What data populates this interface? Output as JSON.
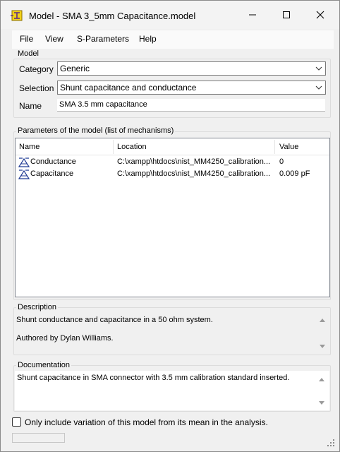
{
  "window": {
    "title": "Model - SMA 3_5mm Capacitance.model"
  },
  "menu": {
    "items": [
      "File",
      "View",
      "S-Parameters",
      "Help"
    ]
  },
  "model_group": {
    "title": "Model",
    "category_label": "Category",
    "category_value": "Generic",
    "selection_label": "Selection",
    "selection_value": "Shunt capacitance and conductance",
    "name_label": "Name",
    "name_value": "SMA 3.5 mm capacitance"
  },
  "parameters_group": {
    "title": "Parameters of the model (list of mechanisms)",
    "columns": [
      "Name",
      "Location",
      "Value"
    ],
    "rows": [
      {
        "name": "Conductance",
        "location": "C:\\xampp\\htdocs\\nist_MM4250_calibration...",
        "value": "0",
        "icon": "mechanism-icon"
      },
      {
        "name": "Capacitance",
        "location": "C:\\xampp\\htdocs\\nist_MM4250_calibration...",
        "value": "0.009  pF",
        "icon": "mechanism-icon"
      }
    ]
  },
  "description_group": {
    "title": "Description",
    "line1": "Shunt conductance and capacitance in a 50 ohm system.",
    "line2": "Authored by Dylan Williams."
  },
  "documentation_group": {
    "title": "Documentation",
    "text": "Shunt capacitance in SMA connector with 3.5 mm calibration standard inserted."
  },
  "options": {
    "checkbox_label": "Only include variation of this model from its mean in the analysis.",
    "checkbox_checked": false
  },
  "icons": {
    "app": "app-icon",
    "minimize": "minimize-icon",
    "maximize": "maximize-icon",
    "close": "close-icon",
    "dropdown": "chevron-down-icon",
    "scroll_up": "scroll-up-icon",
    "scroll_down": "scroll-down-icon",
    "grip": "resize-grip-icon"
  }
}
